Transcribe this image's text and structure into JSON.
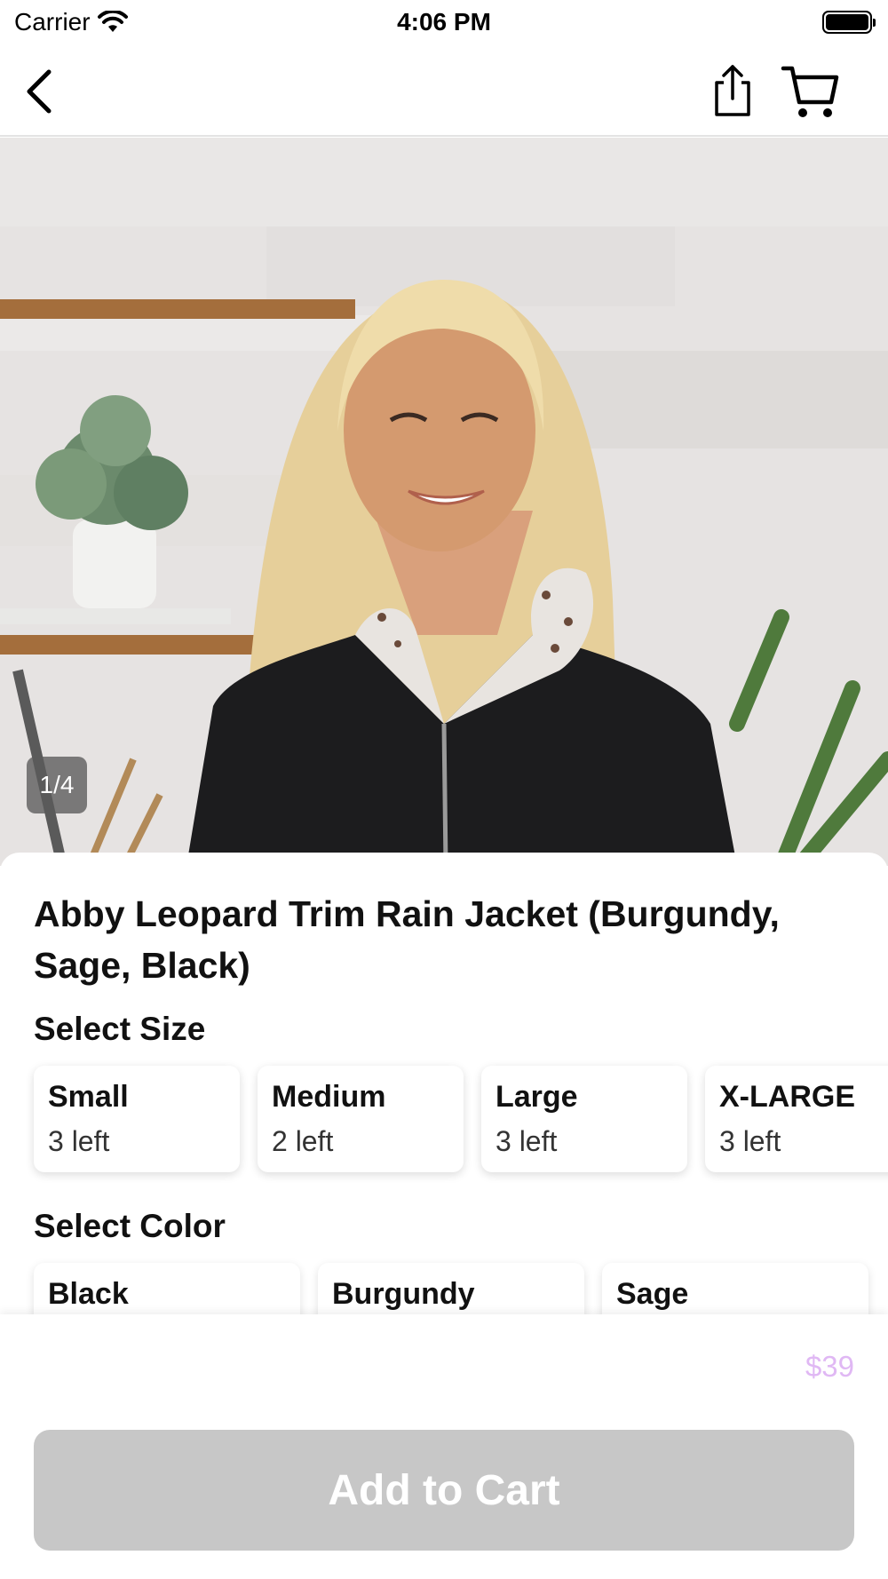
{
  "status_bar": {
    "carrier": "Carrier",
    "time": "4:06 PM"
  },
  "nav": {
    "icons": [
      "chevron-left-icon",
      "share-icon",
      "cart-icon"
    ]
  },
  "gallery": {
    "indicator": "1/4",
    "current": 1,
    "total": 4
  },
  "product": {
    "title": "Abby Leopard Trim Rain Jacket (Burgundy, Sage, Black)",
    "price": "$39"
  },
  "sizes": {
    "heading": "Select Size",
    "options": [
      {
        "name": "Small",
        "stock": "3 left"
      },
      {
        "name": "Medium",
        "stock": "2 left"
      },
      {
        "name": "Large",
        "stock": "3 left"
      },
      {
        "name": "X-LARGE",
        "stock": "3 left"
      }
    ]
  },
  "colors": {
    "heading": "Select Color",
    "options": [
      {
        "name": "Black"
      },
      {
        "name": "Burgundy"
      },
      {
        "name": "Sage"
      }
    ]
  },
  "footer": {
    "button_label": "Add to Cart"
  },
  "theme": {
    "price_color": "#e0b8f4",
    "button_disabled_bg": "#c7c7c7",
    "jacket_color": "#1c1c1e"
  }
}
